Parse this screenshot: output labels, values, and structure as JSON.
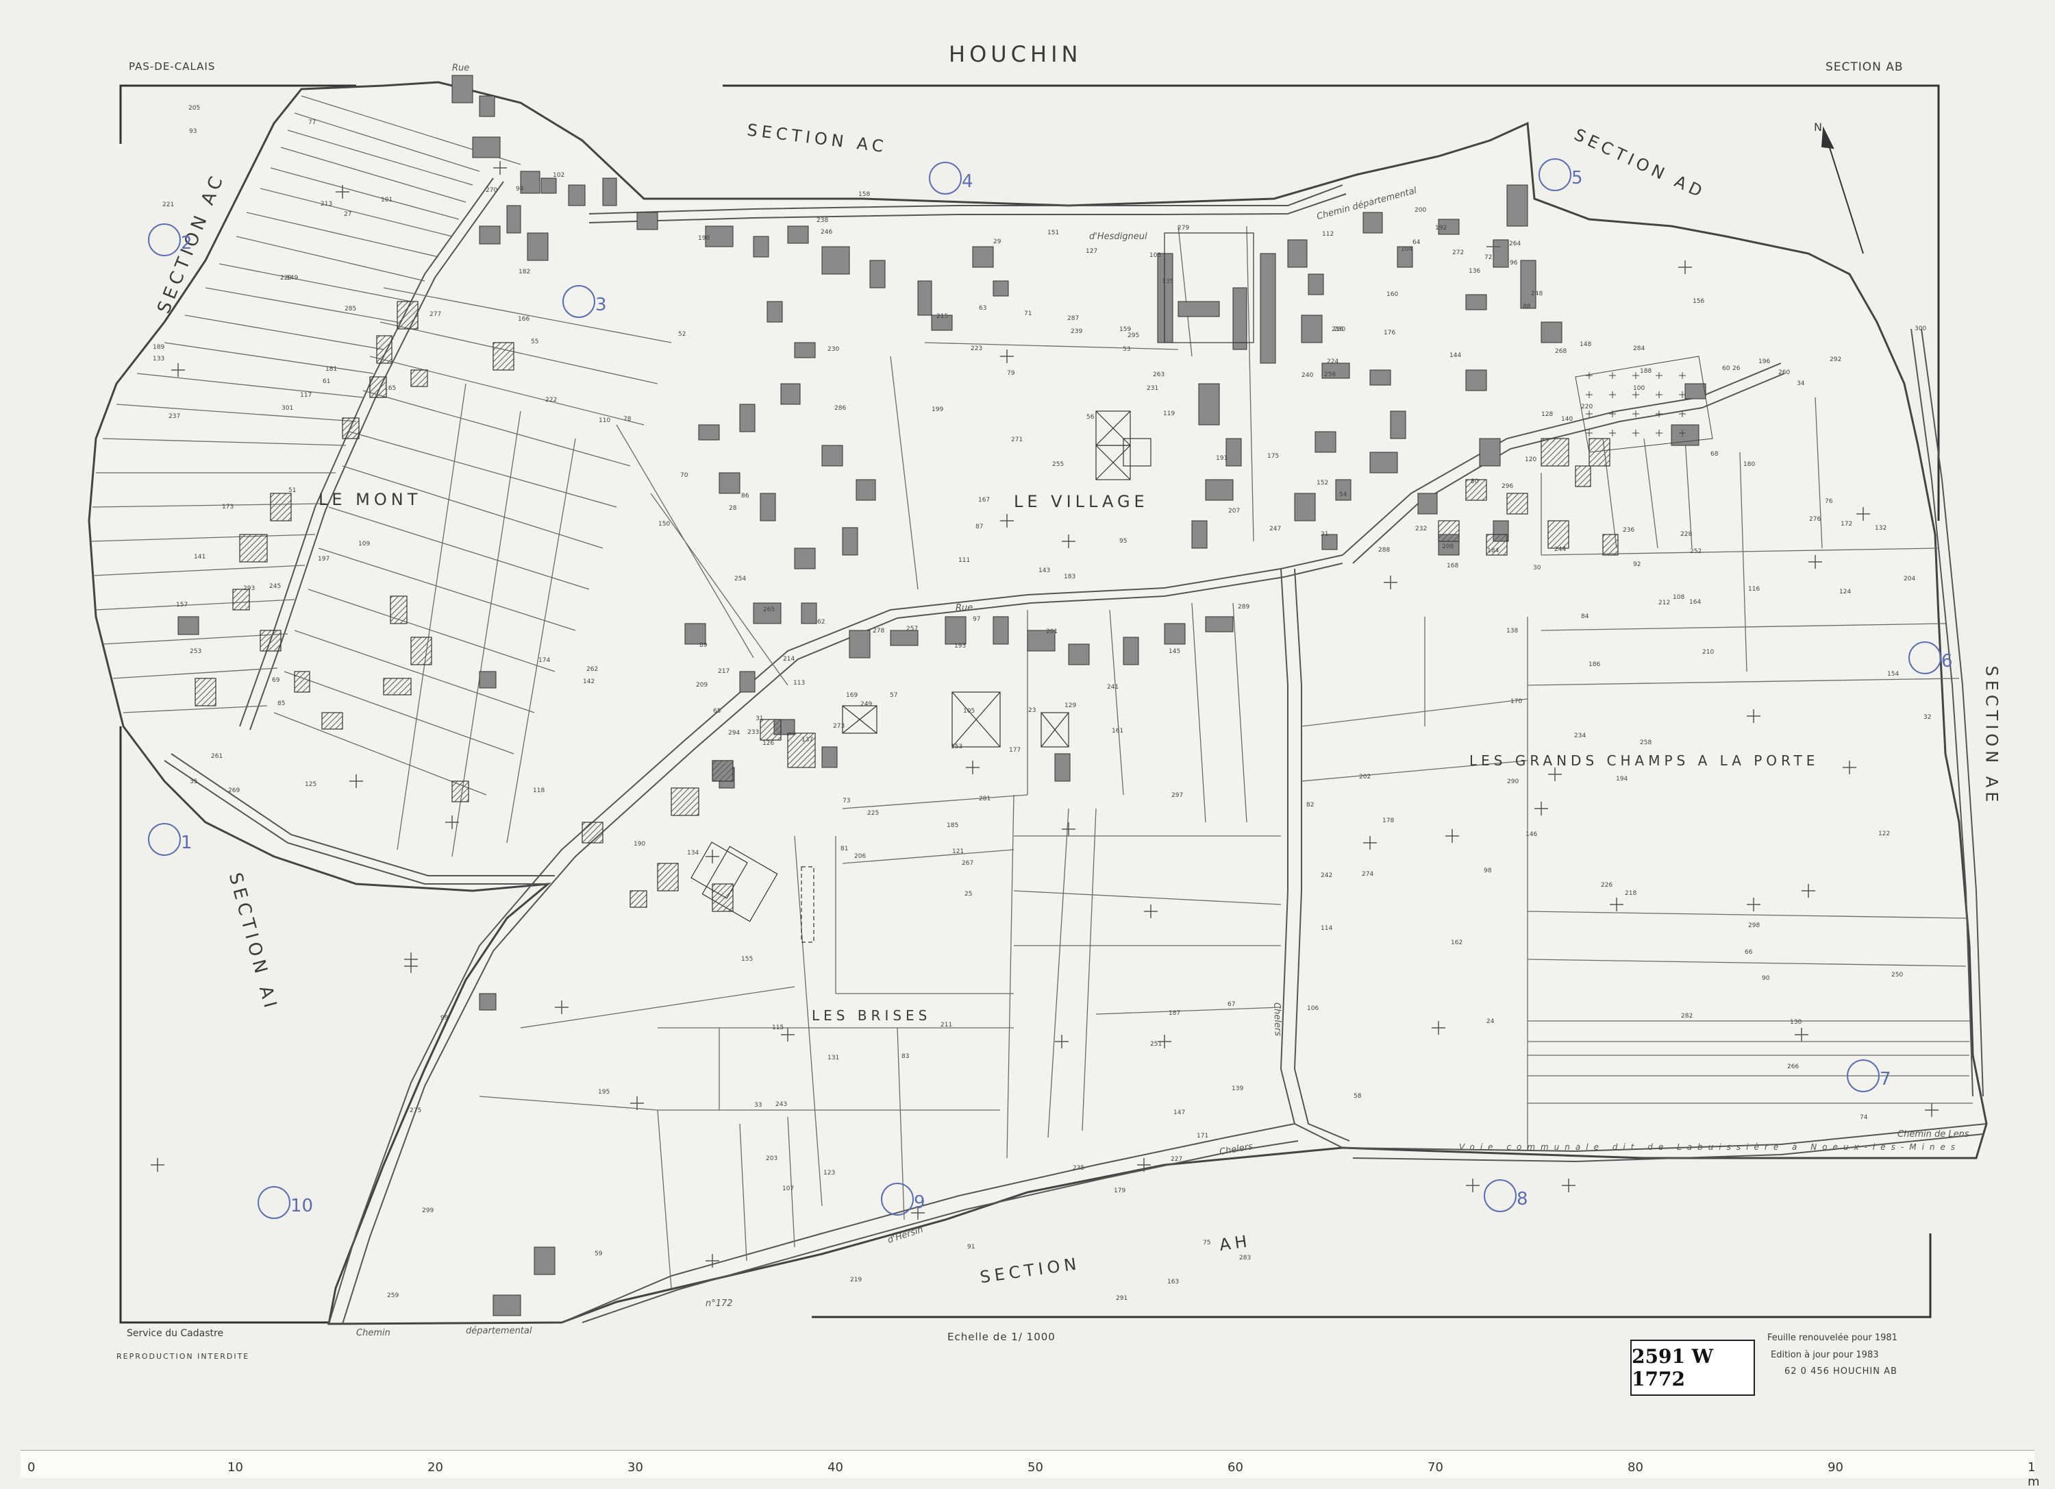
{
  "header": {
    "department": "PAS-DE-CALAIS",
    "commune": "HOUCHIN",
    "section": "SECTION AB"
  },
  "adjacent_sections": {
    "ac_top": "SECTION AC",
    "ac_left": "SECTION AC",
    "ad": "SECTION AD",
    "ae": "SECTION AE",
    "ai": "SECTION AI",
    "ah": "SECTION AH"
  },
  "places": {
    "le_mont": "LE MONT",
    "le_village": "LE VILLAGE",
    "les_grands_champs": "LES GRANDS CHAMPS A LA PORTE",
    "les_brises": "LES BRISES"
  },
  "roads": {
    "rue_top": "Rue",
    "hesdigneul": "d'Hesdigneul",
    "chemin_dep": "Chemin départemental",
    "rue_mid": "Rue",
    "voie": "Voie communale dit de Labuissière à Noeux-les-Mines",
    "chemin_de_lens": "Chemin de Lens",
    "chemin_bottom": "Chemin",
    "departemental": "départemental",
    "chelers": "Chelers",
    "chelers2": "Chelers",
    "hersin": "d'Hersin",
    "no172": "n°172"
  },
  "footer": {
    "service": "Service du Cadastre",
    "reproduction": "REPRODUCTION INTERDITE",
    "scale": "Echelle de 1/ 1000",
    "renewed": "Feuille renouvelée pour 1981",
    "edition": "Edition à jour pour 1983",
    "code": "62 0 456 HOUCHIN AB",
    "archive_ref": "2591 W 1772"
  },
  "north_label": "N",
  "handwritten": [
    "1",
    "2",
    "3",
    "4",
    "5",
    "6",
    "7",
    "8",
    "9",
    "10"
  ],
  "parcels": [
    "51",
    "55",
    "56",
    "21",
    "23",
    "24",
    "25",
    "26",
    "27",
    "28",
    "29",
    "30",
    "31",
    "32",
    "33",
    "34",
    "35",
    "52",
    "53",
    "54",
    "57",
    "58",
    "59",
    "60",
    "61",
    "62",
    "63",
    "64",
    "65",
    "66",
    "67",
    "68",
    "69",
    "70",
    "71",
    "72",
    "73",
    "74",
    "75",
    "76",
    "77",
    "78",
    "79",
    "80",
    "81",
    "82",
    "83",
    "84",
    "85",
    "86",
    "87",
    "88",
    "89",
    "90",
    "91",
    "92",
    "93",
    "94",
    "95",
    "96",
    "97",
    "98",
    "99",
    "100",
    "101",
    "102",
    "103",
    "104",
    "105",
    "106",
    "107",
    "108",
    "109",
    "110",
    "111",
    "112",
    "113",
    "114",
    "115",
    "116",
    "117",
    "118",
    "119",
    "120",
    "121",
    "122",
    "123",
    "124",
    "125",
    "126",
    "127",
    "128",
    "129",
    "130",
    "131",
    "132",
    "133",
    "134",
    "135",
    "136",
    "137",
    "138",
    "139",
    "140",
    "141",
    "142",
    "143",
    "144",
    "145",
    "146",
    "147",
    "148",
    "149",
    "150",
    "151",
    "152",
    "153",
    "154",
    "155",
    "156",
    "157",
    "158",
    "159",
    "160",
    "161",
    "162",
    "163",
    "164",
    "165",
    "166",
    "167",
    "168",
    "169",
    "170",
    "171",
    "172",
    "173",
    "174",
    "175",
    "176",
    "177",
    "178",
    "179",
    "180",
    "181",
    "182",
    "183",
    "184",
    "185",
    "186",
    "187",
    "188",
    "189",
    "190",
    "191",
    "192",
    "193",
    "194",
    "195",
    "196",
    "197",
    "198",
    "199",
    "200",
    "201",
    "202",
    "203",
    "204",
    "205",
    "206",
    "207",
    "208",
    "209",
    "210",
    "211",
    "212",
    "213",
    "214",
    "215",
    "216",
    "217",
    "218",
    "219",
    "220",
    "221",
    "222",
    "223",
    "224",
    "225",
    "226",
    "227",
    "228",
    "229",
    "230",
    "231",
    "232",
    "233",
    "234",
    "235",
    "236",
    "237",
    "238",
    "239",
    "240",
    "241",
    "242",
    "243",
    "244",
    "245",
    "246",
    "247",
    "248",
    "249",
    "250",
    "251",
    "252",
    "253",
    "254",
    "255",
    "256",
    "257",
    "258",
    "259",
    "260",
    "261",
    "262",
    "263",
    "264",
    "265",
    "266",
    "267",
    "268",
    "269",
    "270",
    "271",
    "272",
    "273",
    "274",
    "275",
    "276",
    "277",
    "278",
    "279",
    "280",
    "281",
    "282",
    "283",
    "284",
    "285",
    "286",
    "287",
    "288",
    "289",
    "290",
    "291",
    "292",
    "293",
    "294",
    "295",
    "296",
    "297",
    "298",
    "299",
    "300",
    "301"
  ],
  "ruler_labels": [
    "0",
    "10",
    "20",
    "30",
    "40",
    "50",
    "60",
    "70",
    "80",
    "90",
    "1 m"
  ],
  "colors": {
    "paper": "#f1f0ec",
    "ink": "#4a4a4a",
    "building": "#8a8a8a",
    "handwriting": "#5b6fb0"
  }
}
